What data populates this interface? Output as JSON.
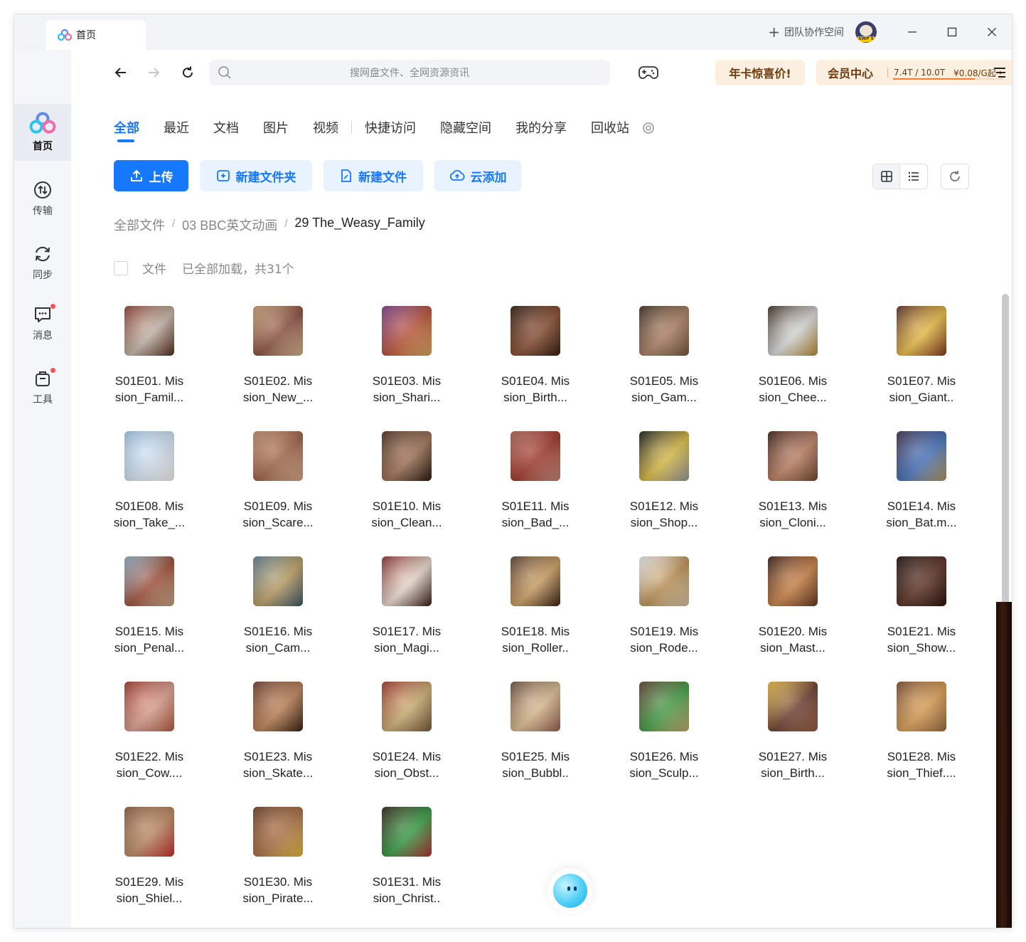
{
  "titlebar": {
    "tab_label": "首页",
    "team_label": "团队协作空间",
    "avatar_badge": "SWP 5"
  },
  "sidebar": {
    "items": [
      {
        "label": "首页",
        "icon": "baidu-logo-icon",
        "active": true
      },
      {
        "label": "传输",
        "icon": "transfer-icon"
      },
      {
        "label": "同步",
        "icon": "sync-icon"
      },
      {
        "label": "消息",
        "icon": "message-icon"
      },
      {
        "label": "工具",
        "icon": "tools-icon"
      }
    ]
  },
  "search": {
    "placeholder": "搜网盘文件、全网资源资讯"
  },
  "promo": {
    "label": "年卡惊喜价!"
  },
  "vip": {
    "label": "会员中心",
    "quota": "7.4T / 10.0T",
    "price": "¥0.08/G起",
    "usage_fraction": 0.74
  },
  "categories": [
    "全部",
    "最近",
    "文档",
    "图片",
    "视频",
    "快捷访问",
    "隐藏空间",
    "我的分享",
    "回收站"
  ],
  "actions": {
    "upload": "上传",
    "new_folder": "新建文件夹",
    "new_file": "新建文件",
    "cloud_add": "云添加"
  },
  "breadcrumb": [
    "全部文件",
    "03 BBC英文动画",
    "29 The_Weasy_Family"
  ],
  "list_header": {
    "label": "文件",
    "status": "已全部加载，共31个"
  },
  "colors": {
    "accent": "#1677ff",
    "promo_text": "#6e3a0e",
    "promo_bg": "#fbefe0"
  },
  "files": [
    {
      "line1": "S01E01. Mis",
      "line2": "sion_Famil...",
      "colors": [
        "#8b3a2a",
        "#c8b8a8",
        "#5a2a1a"
      ]
    },
    {
      "line1": "S01E02. Mis",
      "line2": "sion_New_...",
      "colors": [
        "#c7a070",
        "#8a4a3a",
        "#e0c090"
      ]
    },
    {
      "line1": "S01E03. Mis",
      "line2": "sion_Shari...",
      "colors": [
        "#7a3a8a",
        "#c05030",
        "#e0b060"
      ]
    },
    {
      "line1": "S01E04. Mis",
      "line2": "sion_Birth...",
      "colors": [
        "#2a120a",
        "#8a4a2a",
        "#3a1a10"
      ]
    },
    {
      "line1": "S01E05. Mis",
      "line2": "sion_Gam...",
      "colors": [
        "#3a2a1a",
        "#b08060",
        "#7a5a3a"
      ]
    },
    {
      "line1": "S01E06. Mis",
      "line2": "sion_Chee...",
      "colors": [
        "#3a2a1a",
        "#e0e0e0",
        "#c09030"
      ]
    },
    {
      "line1": "S01E07. Mis",
      "line2": "sion_Giant..",
      "colors": [
        "#5a2a1a",
        "#f0c040",
        "#8a3a20"
      ]
    },
    {
      "line1": "S01E08. Mis",
      "line2": "sion_Take_...",
      "colors": [
        "#a0c8e8",
        "#d8e8f8",
        "#ffffff"
      ]
    },
    {
      "line1": "S01E09. Mis",
      "line2": "sion_Scare...",
      "colors": [
        "#c08868",
        "#a06040",
        "#e0b090"
      ]
    },
    {
      "line1": "S01E10. Mis",
      "line2": "sion_Clean...",
      "colors": [
        "#4a2a1a",
        "#a07050",
        "#2a1a10"
      ]
    },
    {
      "line1": "S01E11. Mis",
      "line2": "sion_Bad_...",
      "colors": [
        "#b06050",
        "#a03020",
        "#d09080"
      ]
    },
    {
      "line1": "S01E12. Mis",
      "line2": "sion_Shop...",
      "colors": [
        "#111111",
        "#e0c040",
        "#a0a0a0"
      ]
    },
    {
      "line1": "S01E13. Mis",
      "line2": "sion_Cloni...",
      "colors": [
        "#3a1a10",
        "#c08060",
        "#7a4a30"
      ]
    },
    {
      "line1": "S01E14. Mis",
      "line2": "sion_Bat.m...",
      "colors": [
        "#3a2a4a",
        "#4070c0",
        "#c0a060"
      ]
    },
    {
      "line1": "S01E15. Mis",
      "line2": "sion_Penal...",
      "colors": [
        "#8ab0c8",
        "#a04a30",
        "#d0b090"
      ]
    },
    {
      "line1": "S01E16. Mis",
      "line2": "sion_Cam...",
      "colors": [
        "#5a7a8a",
        "#c0a060",
        "#3a5a6a"
      ]
    },
    {
      "line1": "S01E17. Mis",
      "line2": "sion_Magi...",
      "colors": [
        "#8a2a2a",
        "#f0e0d0",
        "#3a1a10"
      ]
    },
    {
      "line1": "S01E18. Mis",
      "line2": "sion_Roller..",
      "colors": [
        "#5a3a2a",
        "#d0a060",
        "#3a2010"
      ]
    },
    {
      "line1": "S01E19. Mis",
      "line2": "sion_Rode...",
      "colors": [
        "#f0f0f0",
        "#c09050",
        "#e0d0b0"
      ]
    },
    {
      "line1": "S01E20. Mis",
      "line2": "sion_Mast...",
      "colors": [
        "#3a1a10",
        "#d08040",
        "#6a3a20"
      ]
    },
    {
      "line1": "S01E21. Mis",
      "line2": "sion_Show...",
      "colors": [
        "#1a0a05",
        "#5a2a1a",
        "#2a1208"
      ]
    },
    {
      "line1": "S01E22. Mis",
      "line2": "sion_Cow....",
      "colors": [
        "#a03020",
        "#e0a090",
        "#c06040"
      ]
    },
    {
      "line1": "S01E23. Mis",
      "line2": "sion_Skate...",
      "colors": [
        "#6a3a2a",
        "#c08050",
        "#3a2010"
      ]
    },
    {
      "line1": "S01E24. Mis",
      "line2": "sion_Obst...",
      "colors": [
        "#a03020",
        "#d0b070",
        "#7a5a3a"
      ]
    },
    {
      "line1": "S01E25. Mis",
      "line2": "sion_Bubbl..",
      "colors": [
        "#6a4a3a",
        "#e0c090",
        "#a06050"
      ]
    },
    {
      "line1": "S01E26. Mis",
      "line2": "sion_Sculp...",
      "colors": [
        "#5a3a2a",
        "#40a040",
        "#d0b070"
      ]
    },
    {
      "line1": "S01E27. Mis",
      "line2": "sion_Birth...",
      "colors": [
        "#f0c040",
        "#6a3a2a",
        "#a06040"
      ]
    },
    {
      "line1": "S01E28. Mis",
      "line2": "sion_Thief....",
      "colors": [
        "#7a4a2a",
        "#e0a050",
        "#a07040"
      ]
    },
    {
      "line1": "S01E29. Mis",
      "line2": "sion_Shiel...",
      "colors": [
        "#8a5a3a",
        "#c08a60",
        "#d03030"
      ]
    },
    {
      "line1": "S01E30. Mis",
      "line2": "sion_Pirate...",
      "colors": [
        "#6a3a20",
        "#b07040",
        "#f0c040"
      ]
    },
    {
      "line1": "S01E31. Mis",
      "line2": "sion_Christ..",
      "colors": [
        "#2a1a10",
        "#30a040",
        "#c03030"
      ]
    }
  ]
}
